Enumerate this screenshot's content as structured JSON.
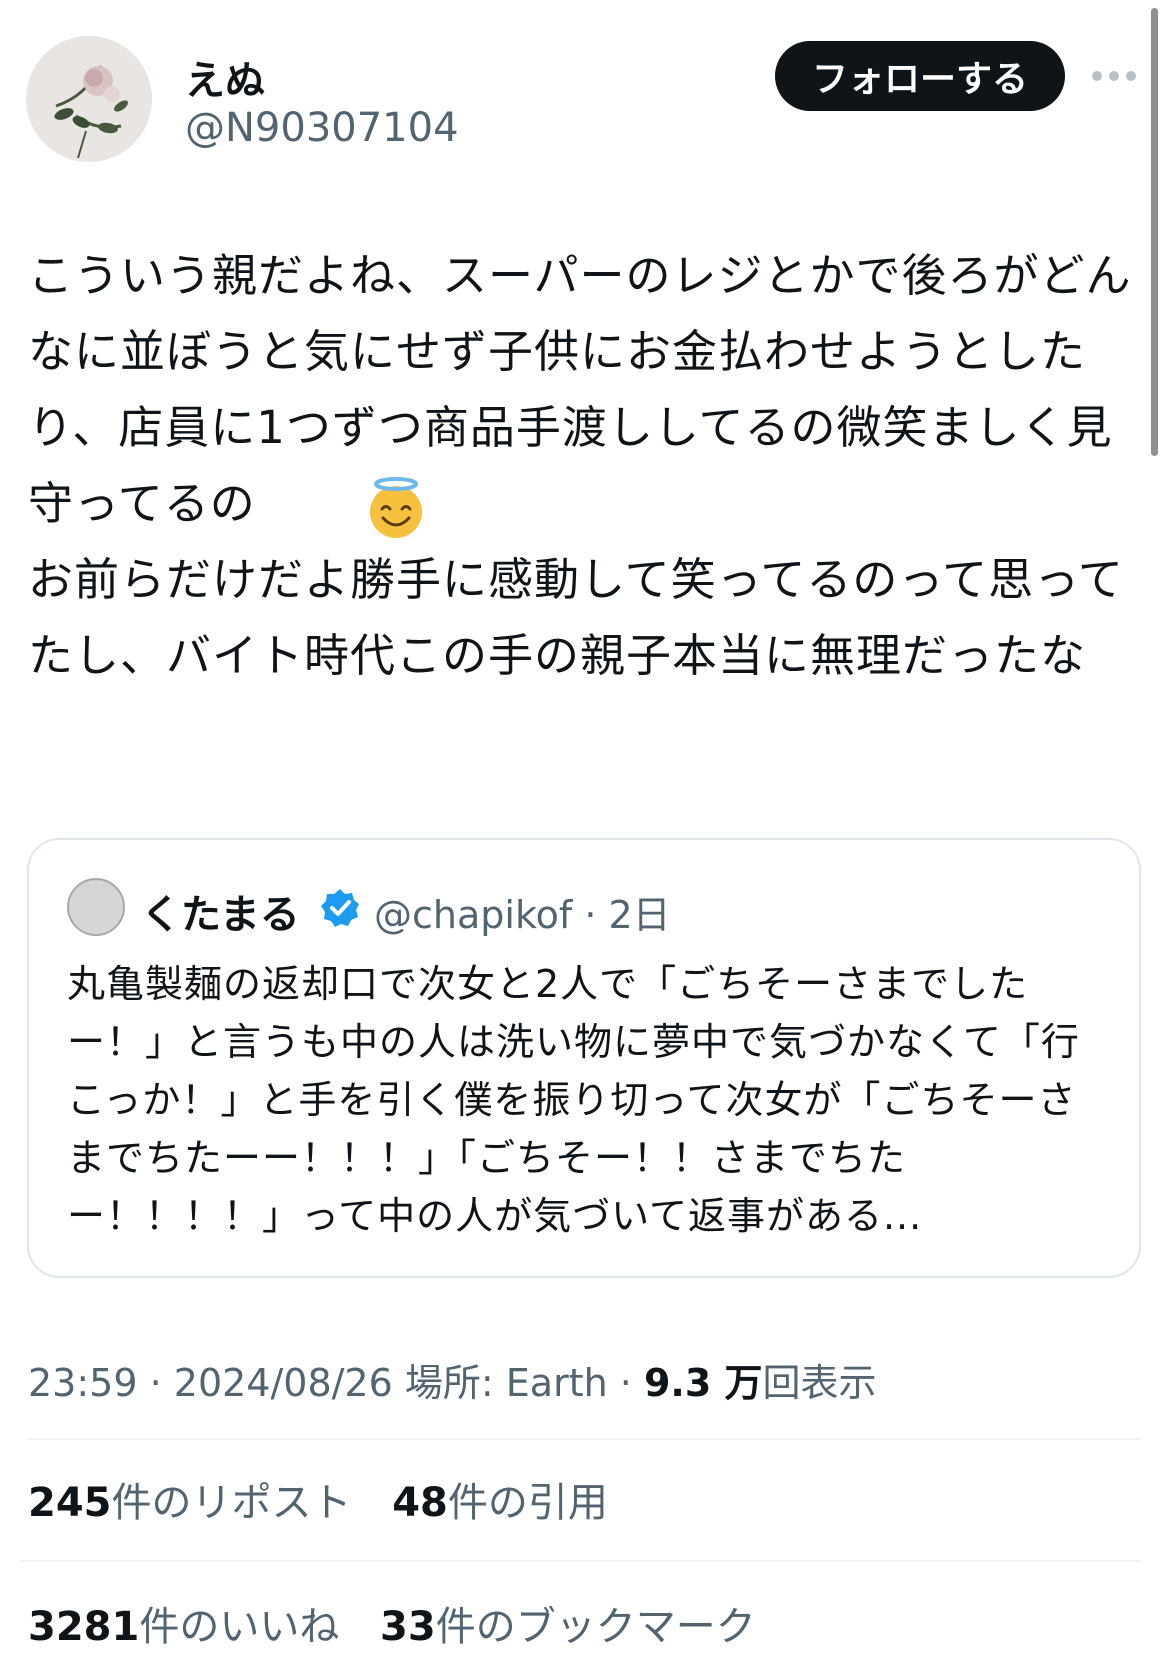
{
  "author": {
    "display_name": "えぬ",
    "handle": "@N90307104",
    "avatar": "rose-photo-avatar"
  },
  "follow_label": "フォローする",
  "tweet": {
    "text": "こういう親だよね、スーパーのレジとかで後ろがどんなに並ぼうと気にせず子供にお金払わせようとしたり、店員に1つずつ商品手渡ししてるの微笑ましく見守ってるの",
    "text_line2": "お前らだけだよ勝手に感動して笑ってるのって思ってたし、バイト時代この手の親子本当に無理だったな",
    "emoji": "smiling-face-with-halo"
  },
  "quote": {
    "name": "くたまる",
    "handle": "@chapikof",
    "age": "2日",
    "verified_color": "#1d9bf0",
    "text": "丸亀製麺の返却口で次女と2人で「ごちそーさまでしたー！」と言うも中の人は洗い物に夢中で気づかなくて「行こっか！」と手を引く僕を振り切って次女が「ごちそーさまでちたーー！！！」「ごちそー！！さまでちたー！！！！」って中の人が気づいて返事がある..."
  },
  "meta": {
    "time": "23:59",
    "date": "2024/08/26",
    "location": "場所: Earth",
    "views_count": "9.3 万",
    "views_label": "回表示"
  },
  "stats": {
    "reposts_count": "245",
    "reposts_label": "件のリポスト",
    "quotes_count": "48",
    "quotes_label": "件の引用",
    "likes_count": "3281",
    "likes_label": "件のいいね",
    "bookmarks_count": "33",
    "bookmarks_label": "件のブックマーク"
  },
  "colors": {
    "text": "#0f1419",
    "secondary": "#536471",
    "button_bg": "#0f1419",
    "border": "#e1e6ea"
  }
}
